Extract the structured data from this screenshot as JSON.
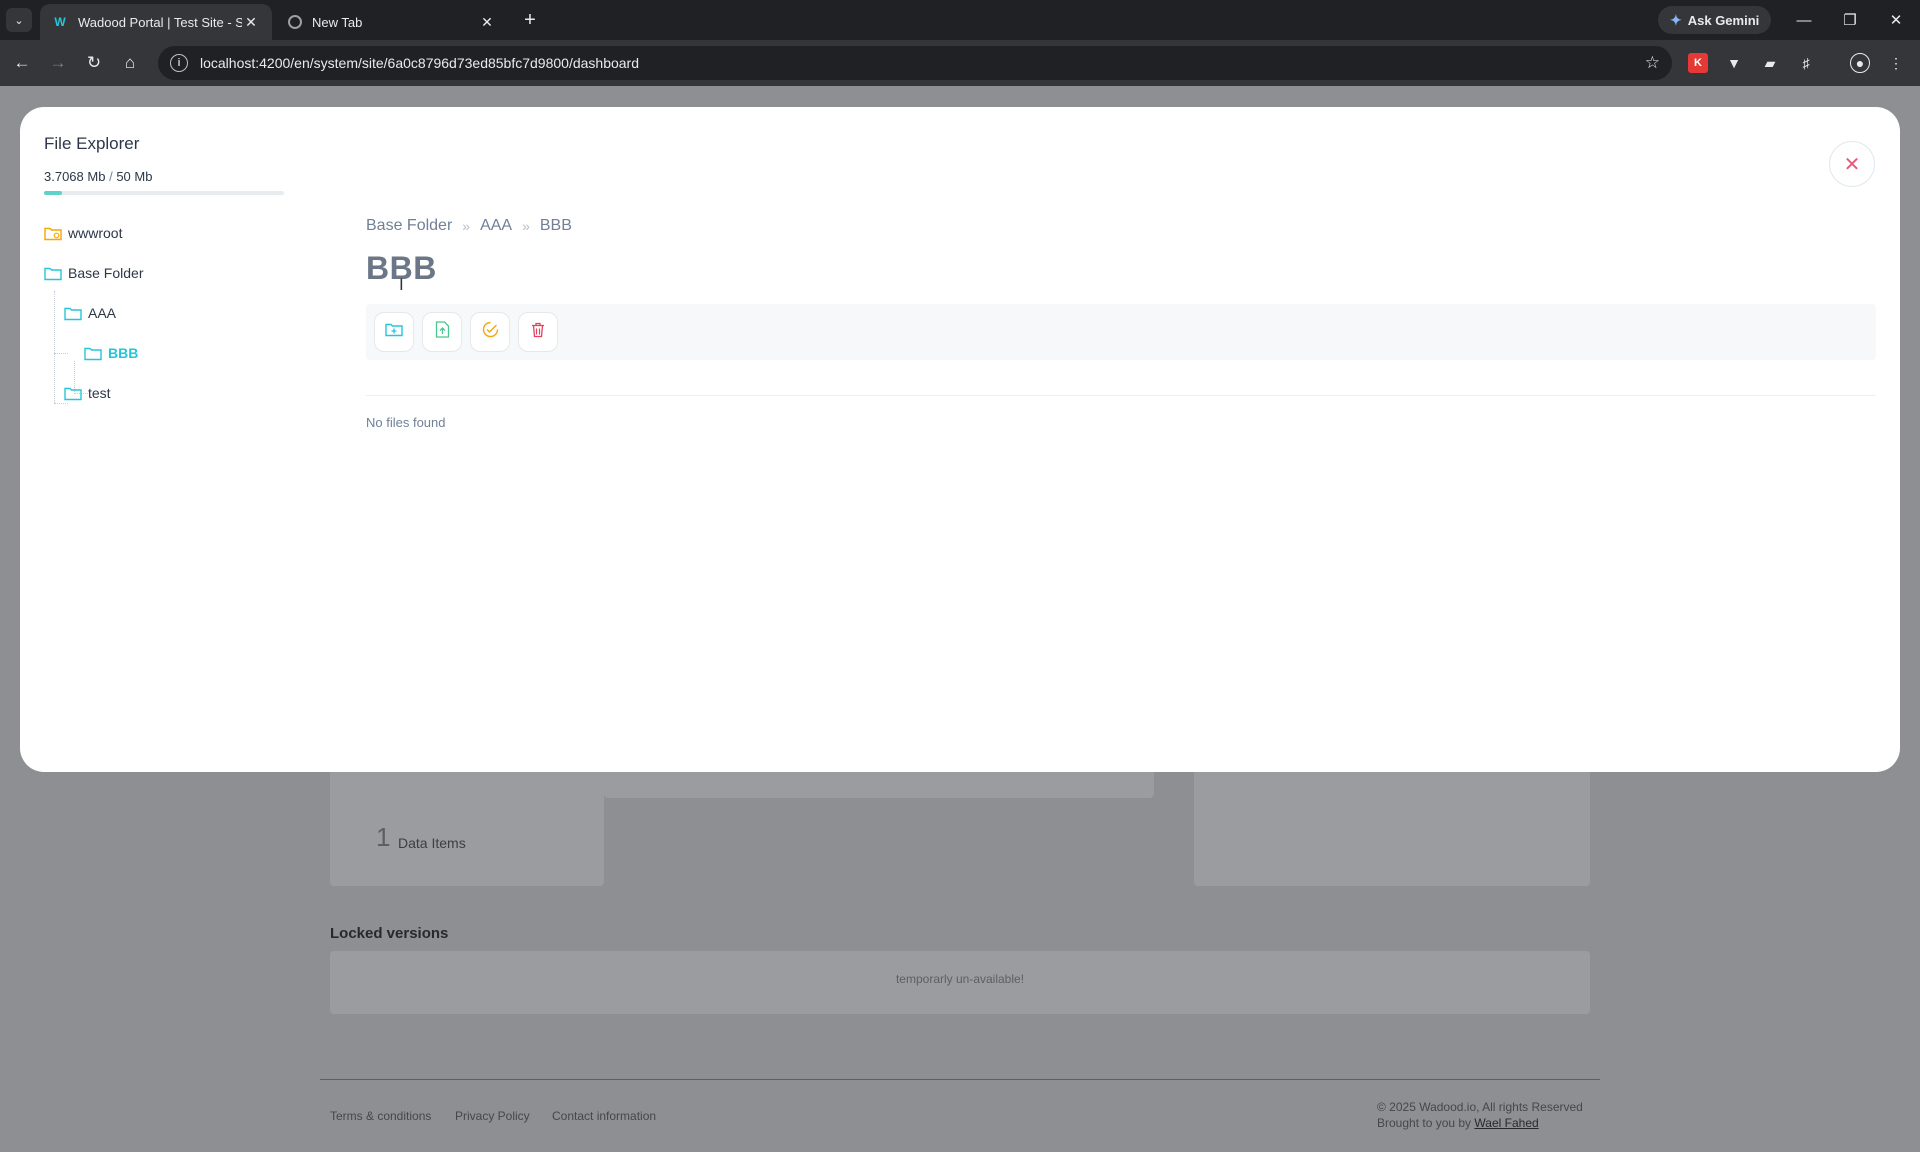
{
  "browser": {
    "tabs": [
      {
        "title": "Wadood Portal | Test Site - Site",
        "active": true
      },
      {
        "title": "New Tab",
        "active": false
      }
    ],
    "url": "localhost:4200/en/system/site/6a0c8796d73ed85bfc7d9800/dashboard",
    "gemini_label": "Ask Gemini"
  },
  "background_page": {
    "stat": {
      "value": "1",
      "label": "Data Items"
    },
    "locked_title": "Locked versions",
    "locked_message": "temporarly un-available!",
    "footer_links": [
      "Terms & conditions",
      "Privacy Policy",
      "Contact information"
    ],
    "copyright": "© 2025 Wadood.io, All rights Reserved",
    "credit_prefix": "Brought to you by",
    "credit_name": "Wael Fahed"
  },
  "file_explorer": {
    "title": "File Explorer",
    "storage": {
      "used": "3.7068 Mb",
      "separator": "/",
      "total": "50 Mb",
      "used_fraction": 0.074
    },
    "tree": [
      {
        "label": "wwwroot",
        "icon": "folder-settings-icon",
        "level": 0
      },
      {
        "label": "Base Folder",
        "icon": "folder-icon",
        "level": 0
      },
      {
        "label": "AAA",
        "icon": "folder-icon",
        "level": 1
      },
      {
        "label": "BBB",
        "icon": "folder-icon",
        "level": 2,
        "active": true
      },
      {
        "label": "test",
        "icon": "folder-icon",
        "level": 1
      }
    ],
    "breadcrumb": [
      "Base Folder",
      "AAA",
      "BBB"
    ],
    "breadcrumb_separator": "»",
    "current_folder": "BBB",
    "actions": [
      "new-folder-icon",
      "upload-file-icon",
      "rename-icon",
      "delete-icon"
    ],
    "empty_message": "No files found",
    "colors": {
      "accent": "#26c6da",
      "delete": "#e53e5e",
      "rename": "#f6a609",
      "upload": "#48c78e"
    }
  }
}
